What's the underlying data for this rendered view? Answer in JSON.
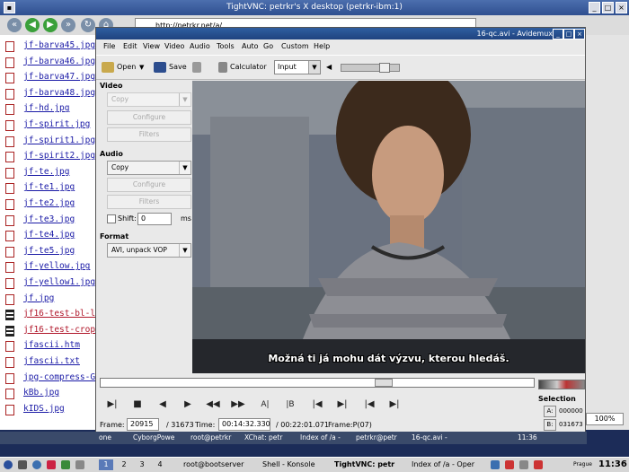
{
  "vnc": {
    "title": "TightVNC: petrkr's X desktop (petrkr-ibm:1)"
  },
  "browser": {
    "url": "http://petrkr.net/a/",
    "file_list": [
      {
        "name": "jf-barva45.jpg",
        "kind": "image"
      },
      {
        "name": "jf-barva46.jpg",
        "kind": "image"
      },
      {
        "name": "jf-barva47.jpg",
        "kind": "image"
      },
      {
        "name": "jf-barva48.jpg",
        "kind": "image"
      },
      {
        "name": "jf-hd.jpg",
        "kind": "image"
      },
      {
        "name": "jf-spirit.jpg",
        "kind": "image"
      },
      {
        "name": "jf-spirit1.jpg",
        "kind": "image"
      },
      {
        "name": "jf-spirit2.jpg",
        "kind": "image"
      },
      {
        "name": "jf-te.jpg",
        "kind": "image"
      },
      {
        "name": "jf-te1.jpg",
        "kind": "image"
      },
      {
        "name": "jf-te2.jpg",
        "kind": "image"
      },
      {
        "name": "jf-te3.jpg",
        "kind": "image"
      },
      {
        "name": "jf-te4.jpg",
        "kind": "image"
      },
      {
        "name": "jf-te5.jpg",
        "kind": "image"
      },
      {
        "name": "jf-yellow.jpg",
        "kind": "image"
      },
      {
        "name": "jf-yellow1.jpg",
        "kind": "image"
      },
      {
        "name": "jf.jpg",
        "kind": "image"
      },
      {
        "name": "jf16-test-bl-l",
        "kind": "video",
        "visited": true
      },
      {
        "name": "jf16-test-crop",
        "kind": "video",
        "visited": true
      },
      {
        "name": "jfascii.htm",
        "kind": "image"
      },
      {
        "name": "jfascii.txt",
        "kind": "image"
      },
      {
        "name": "jpg-compress-G",
        "kind": "image"
      },
      {
        "name": "kBb.jpg",
        "kind": "image"
      },
      {
        "name": "kIDS.jpg",
        "kind": "image"
      }
    ],
    "zoom": "100%"
  },
  "avidemux": {
    "title": "16-qc.avi - Avidemux",
    "menu": [
      "File",
      "Edit",
      "View",
      "Video",
      "Audio",
      "Tools",
      "Auto",
      "Go",
      "Custom",
      "Help"
    ],
    "toolbar": {
      "open": "Open",
      "save": "Save",
      "calculator": "Calculator",
      "input_select": "Input"
    },
    "video_section": {
      "label": "Video",
      "codec": "Copy",
      "configure": "Configure",
      "filters": "Filters"
    },
    "audio_section": {
      "label": "Audio",
      "codec": "Copy",
      "configure": "Configure",
      "filters": "Filters",
      "shift_label": "Shift:",
      "shift_value": "0",
      "shift_unit": "ms"
    },
    "format_section": {
      "label": "Format",
      "container": "AVI, unpack VOP"
    },
    "subtitle": "Možná ti já mohu dát výzvu, kterou hledáš.",
    "status": {
      "frame_label": "Frame:",
      "frame_value": "20915",
      "frame_total": "/ 31673",
      "time_label": "Time:",
      "time_value": "00:14:32.330",
      "time_total": "/ 00:22:01.071",
      "frame_type": "Frame:P(07)"
    },
    "timeline_position": 0.66,
    "selection": {
      "label": "Selection",
      "a_label": "A:",
      "a_value": "000000",
      "b_label": "B:",
      "b_value": "031673"
    }
  },
  "inner_taskbar": {
    "items": [
      "one",
      "CyborgPowe",
      "root@petrkr",
      "XChat: petr",
      "Index of /a -",
      "petrkr@petr",
      "16-qc.avi -"
    ],
    "clock": "11:36"
  },
  "outer_taskbar": {
    "workspaces": [
      "1",
      "2",
      "3",
      "4"
    ],
    "items": [
      "root@bootserver",
      "Shell - Konsole",
      "TightVNC: petr",
      "Index of /a - Oper"
    ],
    "location": "Prague",
    "clock": "11:36"
  }
}
